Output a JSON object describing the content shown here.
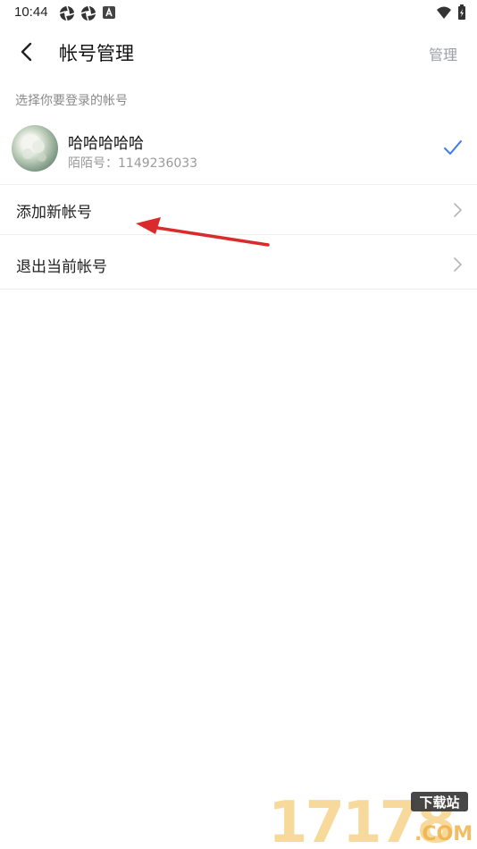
{
  "status_bar": {
    "time": "10:44"
  },
  "header": {
    "title": "帐号管理",
    "manage_label": "管理"
  },
  "section_label": "选择你要登录的帐号",
  "account": {
    "name": "哈哈哈哈哈",
    "id_text": "陌陌号：1149236033"
  },
  "menu": [
    {
      "label": "添加新帐号"
    },
    {
      "label": "退出当前帐号"
    }
  ],
  "watermark": {
    "digits": "17178",
    "tag": "下载站",
    "suffix": ".COM"
  },
  "colors": {
    "accent": "#3b7bf6",
    "arrow": "#d92b2b"
  }
}
